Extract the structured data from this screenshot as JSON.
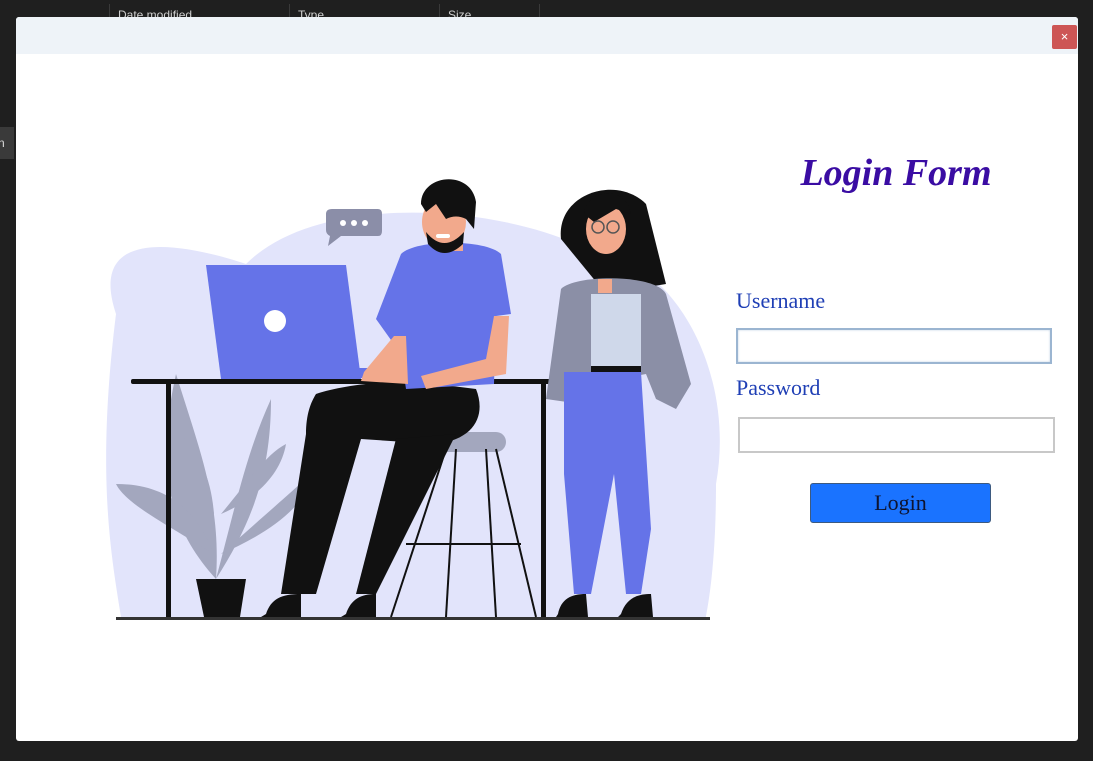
{
  "background": {
    "columns": [
      {
        "label": "Date modified"
      },
      {
        "label": "Type"
      },
      {
        "label": "Size"
      }
    ],
    "side_chip": "n"
  },
  "dialog": {
    "close_glyph": "×",
    "title": "Login Form",
    "username_label": "Username",
    "username_value": "",
    "password_label": "Password",
    "password_value": "",
    "login_label": "Login",
    "colors": {
      "title": "#3a0ca3",
      "labels": "#1f3fb5",
      "button": "#1a73ff",
      "close": "#cd5555"
    }
  }
}
